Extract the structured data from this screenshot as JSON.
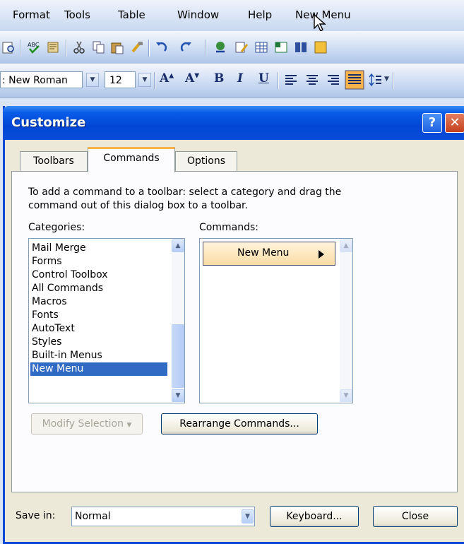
{
  "menubar": {
    "items": [
      "Format",
      "Tools",
      "Table",
      "Window",
      "Help",
      "New Menu"
    ],
    "mnemonics": [
      "o",
      "T",
      "a",
      "W",
      "H",
      ""
    ]
  },
  "formatting_toolbar": {
    "font_name": ": New Roman",
    "font_size": "12",
    "grow_font_glyph": "A",
    "shrink_font_glyph": "A",
    "bold_glyph": "B",
    "italic_glyph": "I",
    "underline_glyph": "U"
  },
  "dialog": {
    "title": "Customize",
    "help_glyph": "?",
    "close_glyph": "✕",
    "tabs": [
      "Toolbars",
      "Commands",
      "Options"
    ],
    "active_tab": "Commands",
    "instructions_line1": "To add a command to a toolbar: select a category and drag the",
    "instructions_line2": "command out of this dialog box to a toolbar.",
    "categories_label": "Categories:",
    "commands_label": "Commands:",
    "categories": [
      "Mail Merge",
      "Forms",
      "Control Toolbox",
      "All Commands",
      "Macros",
      "Fonts",
      "AutoText",
      "Styles",
      "Built-in Menus",
      "New Menu"
    ],
    "selected_category": "New Menu",
    "commands": [
      "New Menu"
    ],
    "modify_selection": "Modify Selection",
    "rearrange_commands": "Rearrange Commands...",
    "save_in_label": "Save in:",
    "save_in_value": "Normal",
    "keyboard_button": "Keyboard...",
    "close_button": "Close"
  },
  "colors": {
    "titlebar": "#0046d5",
    "selection": "#316ac5",
    "active_tab_accent": "#f8b24a",
    "dialog_bg": "#ece9d8"
  }
}
